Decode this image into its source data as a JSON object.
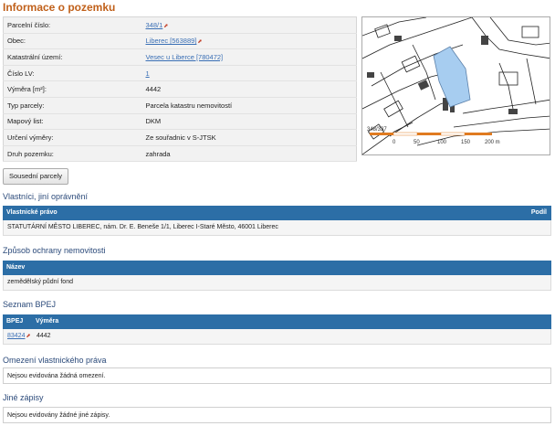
{
  "page": {
    "title": "Informace o pozemku"
  },
  "parcel": {
    "rows": [
      {
        "label": "Parcelní číslo:",
        "value": "348/1",
        "link": true
      },
      {
        "label": "Obec:",
        "value": "Liberec [563889]",
        "link": true
      },
      {
        "label": "Katastrální území:",
        "value": "Vesec u Liberce [780472]",
        "link": true
      },
      {
        "label": "Číslo LV:",
        "value": "1",
        "link": true
      },
      {
        "label": "Výměra [m²]:",
        "value": "4442",
        "link": false
      },
      {
        "label": "Typ parcely:",
        "value": "Parcela katastru nemovitostí",
        "link": false
      },
      {
        "label": "Mapový list:",
        "value": "DKM",
        "link": false
      },
      {
        "label": "Určení výměry:",
        "value": "Ze souřadnic v S-JTSK",
        "link": false
      },
      {
        "label": "Druh pozemku:",
        "value": "zahrada",
        "link": false
      }
    ]
  },
  "map": {
    "parcel_label": "348/337",
    "scale_labels": [
      "0",
      "50",
      "100",
      "150",
      "200 m"
    ],
    "highlight_color": "#a7cdf0",
    "scale_color": "#e07b20"
  },
  "neighbors_button": "Sousední parcely",
  "owners": {
    "title": "Vlastníci, jiní oprávnění",
    "col1": "Vlastnické právo",
    "col2": "Podíl",
    "row": "STATUTÁRNÍ MĚSTO LIBEREC, nám. Dr. E. Beneše 1/1, Liberec I-Staré Město, 46001 Liberec"
  },
  "protection": {
    "title": "Způsob ochrany nemovitosti",
    "col1": "Název",
    "row": "zemědělský půdní fond"
  },
  "bpej": {
    "title": "Seznam BPEJ",
    "col1": "BPEJ",
    "col2": "Výměra",
    "code": "83424",
    "area": "4442"
  },
  "restrictions": {
    "title": "Omezení vlastnického práva",
    "text": "Nejsou evidována žádná omezení."
  },
  "other": {
    "title": "Jiné zápisy",
    "text": "Nejsou evidovány žádné jiné zápisy."
  }
}
